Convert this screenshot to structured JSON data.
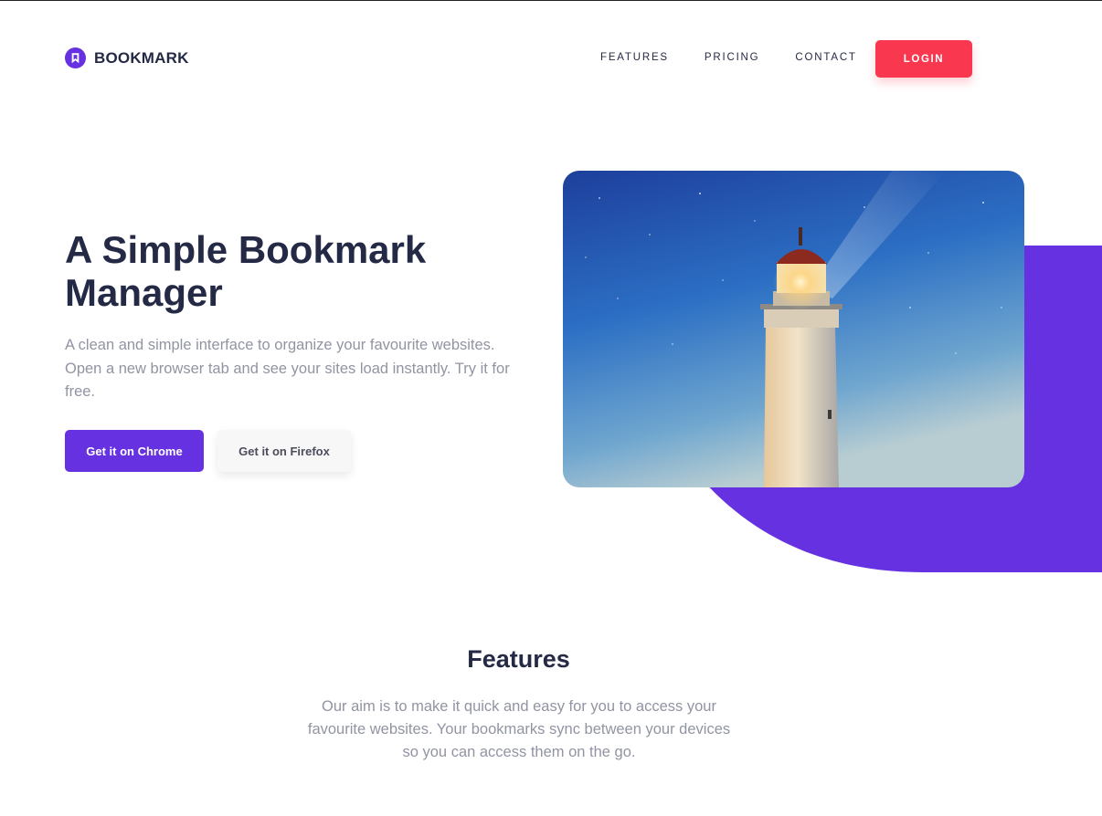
{
  "header": {
    "brand": "BOOKMARK",
    "logo_icon": "bookmark-icon",
    "nav": [
      {
        "label": "FEATURES"
      },
      {
        "label": "PRICING"
      },
      {
        "label": "CONTACT"
      }
    ],
    "login_label": "LOGIN"
  },
  "hero": {
    "title": "A Simple Bookmark Manager",
    "subtitle": "A clean and simple interface to organize your favourite websites. Open a new browser tab and see your sites load instantly. Try it for free.",
    "buttons": {
      "chrome": "Get it on Chrome",
      "firefox": "Get it on Firefox"
    },
    "image": "lighthouse-photo"
  },
  "features": {
    "title": "Features",
    "subtitle": "Our aim is to make it quick and easy for you to access your favourite websites. Your bookmarks sync between your devices so you can access them on the go."
  },
  "colors": {
    "primary": "#6631e0",
    "accent": "#f9384f",
    "heading": "#242a45",
    "body_text": "#9194a2",
    "button_light": "#f7f7f7"
  }
}
